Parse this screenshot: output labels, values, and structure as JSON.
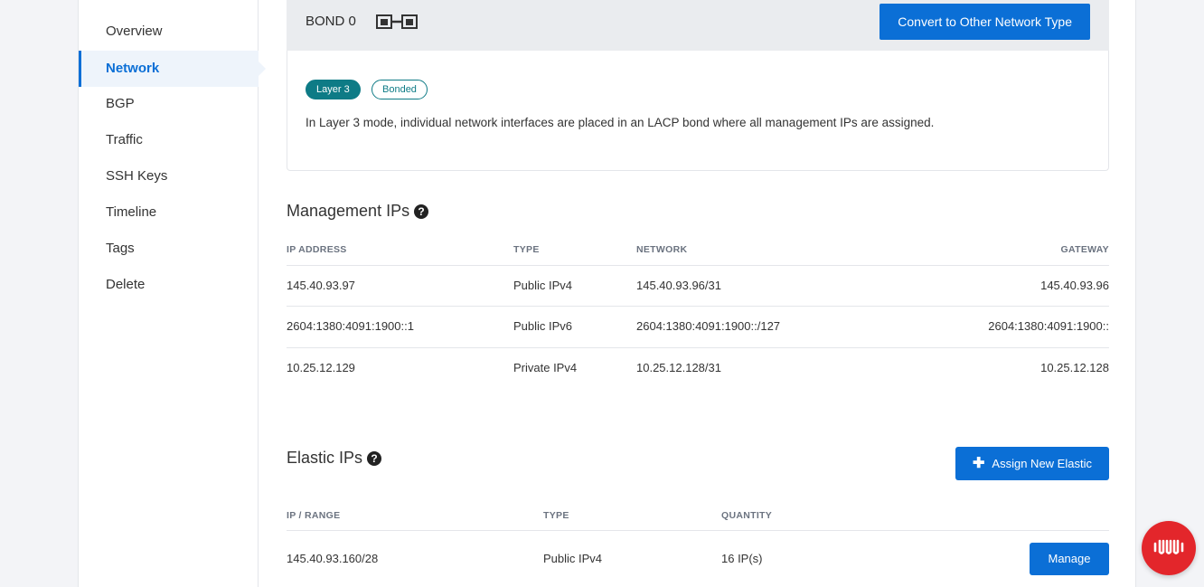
{
  "sidebar": {
    "items": [
      {
        "label": "Overview"
      },
      {
        "label": "Network",
        "active": true
      },
      {
        "label": "BGP"
      },
      {
        "label": "Traffic"
      },
      {
        "label": "SSH Keys"
      },
      {
        "label": "Timeline"
      },
      {
        "label": "Tags"
      },
      {
        "label": "Delete"
      }
    ]
  },
  "bond": {
    "title": "BOND 0",
    "icon": "bonded-ports-icon",
    "convert_label": "Convert to Other Network Type",
    "badges": [
      "Layer 3",
      "Bonded"
    ],
    "description": "In Layer 3 mode, individual network interfaces are placed in an LACP bond where all management IPs are assigned."
  },
  "management_ips": {
    "title": "Management IPs",
    "help_icon": "question-circle-icon",
    "columns": [
      "IP ADDRESS",
      "TYPE",
      "NETWORK",
      "GATEWAY"
    ],
    "rows": [
      {
        "ip": "145.40.93.97",
        "type": "Public IPv4",
        "network": "145.40.93.96/31",
        "gateway": "145.40.93.96"
      },
      {
        "ip": "2604:1380:4091:1900::1",
        "type": "Public IPv6",
        "network": "2604:1380:4091:1900::/127",
        "gateway": "2604:1380:4091:1900::"
      },
      {
        "ip": "10.25.12.129",
        "type": "Private IPv4",
        "network": "10.25.12.128/31",
        "gateway": "10.25.12.128"
      }
    ]
  },
  "elastic_ips": {
    "title": "Elastic IPs",
    "help_icon": "question-circle-icon",
    "assign_label": "Assign New Elastic",
    "columns": [
      "IP / RANGE",
      "TYPE",
      "QUANTITY"
    ],
    "rows": [
      {
        "range": "145.40.93.160/28",
        "type": "Public IPv4",
        "quantity": "16 IP(s)",
        "action": "Manage"
      }
    ]
  },
  "chat": {
    "icon": "equinix-chat-icon",
    "color": "#e3262b"
  },
  "colors": {
    "accent": "#0b6fd6",
    "teal": "#0e7b86"
  }
}
